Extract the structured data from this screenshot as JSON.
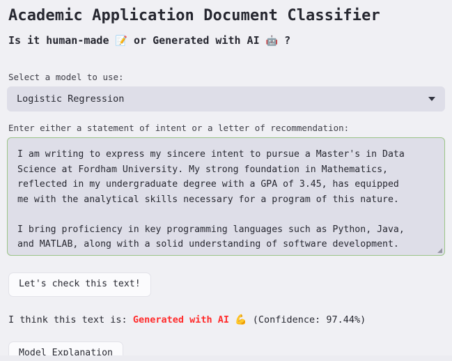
{
  "header": {
    "title": "Academic Application Document Classifier",
    "subtitle_part1": "Is it human-made",
    "subtitle_emoji_human": "📝",
    "subtitle_part2": "or Generated with AI",
    "subtitle_emoji_ai": "🤖",
    "subtitle_part3": "?"
  },
  "model_select": {
    "label": "Select a model to use:",
    "value": "Logistic Regression",
    "caret": "chevron-down-icon"
  },
  "input_text": {
    "label": "Enter either a statement of intent or a letter of recommendation:",
    "value": "I am writing to express my sincere intent to pursue a Master's in Data\nScience at Fordham University. My strong foundation in Mathematics,\nreflected in my undergraduate degree with a GPA of 3.45, has equipped\nme with the analytical skills necessary for a program of this nature.\n\nI bring proficiency in key programming languages such as Python, Java,\nand MATLAB, along with a solid understanding of software development.\nMy academic background includes a comprehensive grasp of advanced",
    "placeholder": ""
  },
  "actions": {
    "check_label": "Let's check this text!",
    "explain_label": "Model Explanation"
  },
  "result": {
    "prefix": "I think this text is:",
    "verdict": "Generated with AI",
    "verdict_emoji": "💪",
    "confidence": "(Confidence: 97.44%)",
    "verdict_color": "#ff2b2b"
  }
}
